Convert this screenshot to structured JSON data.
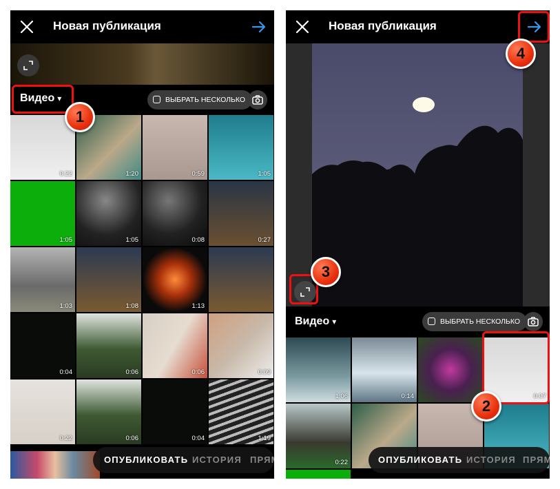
{
  "left": {
    "header": {
      "title": "Новая публикация"
    },
    "subbar": {
      "media_type": "Видео",
      "multi_label": "ВЫБРАТЬ НЕСКОЛЬКО"
    },
    "grid": [
      {
        "dur": "0:22",
        "bg": "linear-gradient(#d8d8d8,#f0f0f0)"
      },
      {
        "dur": "1:20",
        "bg": "linear-gradient(135deg,#2e5e4a,#bba98a 55%,#3e8a86)"
      },
      {
        "dur": "0:59",
        "bg": "linear-gradient(#c8b8b0,#a89890)"
      },
      {
        "dur": "1:05",
        "bg": "linear-gradient(#1f7c8c,#4ab9c5)"
      },
      {
        "dur": "1:05",
        "bg": "#0bae0b"
      },
      {
        "dur": "1:05",
        "bg": "radial-gradient(circle at 45% 30%,#888,#222 60%,#111)"
      },
      {
        "dur": "0:08",
        "bg": "radial-gradient(circle at 40% 30%,#777,#222 55%,#0a0a0a)"
      },
      {
        "dur": "0:27",
        "bg": "linear-gradient(#2a3546,#6a5030)"
      },
      {
        "dur": "1:03",
        "bg": "linear-gradient(#b4b4b4,#6a6a6a 60%,#8a8a7a)"
      },
      {
        "dur": "1:08",
        "bg": "linear-gradient(#2c3a52,#7a5a30)"
      },
      {
        "dur": "1:13",
        "bg": "radial-gradient(circle at 50% 50%,#ff8a3a,#a8300a 35%,#0a0a0a 70%)"
      },
      {
        "dur": "",
        "bg": "linear-gradient(#2c3a52,#7a5a30)"
      },
      {
        "dur": "0:04",
        "bg": "#0a0c0a"
      },
      {
        "dur": "0:06",
        "bg": "linear-gradient(#e0e4e0,#3e5a32 55%,#2a3a22)"
      },
      {
        "dur": "0:06",
        "bg": "linear-gradient(120deg,#d8cfc4,#e6dcd0 50%,#c9503a)"
      },
      {
        "dur": "0:09",
        "bg": "linear-gradient(135deg,#d0a080,#c8b8a8 50%,#eee)"
      },
      {
        "dur": "0:22",
        "bg": "linear-gradient(#e6e2de,#d8d0c8)"
      },
      {
        "dur": "0:06",
        "bg": "linear-gradient(#e0e4e0,#3e5a32 55%,#2a3a22)"
      },
      {
        "dur": "0:04",
        "bg": "#0a0c0a"
      },
      {
        "dur": "1:19",
        "bg": "repeating-linear-gradient(160deg,#222 0 6px,#bbb 6px 10px)"
      }
    ],
    "bottom": {
      "publish": "ОПУБЛИКОВАТЬ",
      "story": "ИСТОРИЯ",
      "live": "ПРЯМ"
    }
  },
  "right": {
    "header": {
      "title": "Новая публикация"
    },
    "subbar": {
      "media_type": "Видео",
      "multi_label": "ВЫБРАТЬ НЕСКОЛЬКО"
    },
    "grid": [
      {
        "dur": "1:06",
        "bg": "linear-gradient(#2e4a52,#7a9aa0 60%,#d0dde0)"
      },
      {
        "dur": "0:14",
        "bg": "linear-gradient(#7a8a96,#d8e4ea 55%,#5e7686)"
      },
      {
        "dur": "",
        "bg": "radial-gradient(circle at 50% 50%,#c03aa0,#4a2050 45%,#2a4a20)"
      },
      {
        "dur": "0:07",
        "bg": "linear-gradient(#d8d8d8,#f0f0f0)"
      },
      {
        "dur": "0:22",
        "bg": "linear-gradient(#b8c8c8,#3a3a30 60%,#2a6a2a)"
      },
      {
        "dur": "",
        "bg": "linear-gradient(135deg,#2e5e4a,#bba98a 55%,#3e8a86)"
      },
      {
        "dur": "",
        "bg": "linear-gradient(#c8b8b0,#a89890)"
      },
      {
        "dur": "",
        "bg": "linear-gradient(#1f7c8c,#4ab9c5)"
      }
    ],
    "bottom": {
      "publish": "ОПУБЛИКОВАТЬ",
      "story": "ИСТОРИЯ",
      "live": "ПРЯМ"
    }
  },
  "markers": [
    "1",
    "2",
    "3",
    "4"
  ],
  "colors": {
    "accent_arrow": "#3897f0",
    "annotation_red": "#e11111",
    "green_strip": "#0bae0b"
  }
}
